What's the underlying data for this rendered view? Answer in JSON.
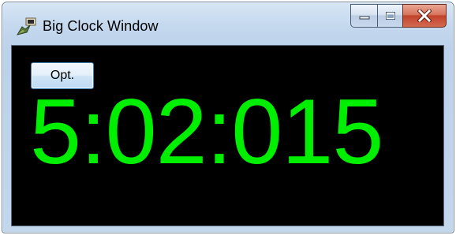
{
  "window": {
    "title": "Big Clock Window",
    "app_icon": "clock-app-icon",
    "caption_buttons": {
      "minimize_icon": "minimize-icon",
      "maximize_icon": "maximize-icon",
      "close_icon": "close-icon"
    }
  },
  "toolbar": {
    "options_label": "Opt."
  },
  "clock": {
    "time": "5:02:015",
    "digit_color": "#00ee00",
    "background_color": "#000000"
  }
}
